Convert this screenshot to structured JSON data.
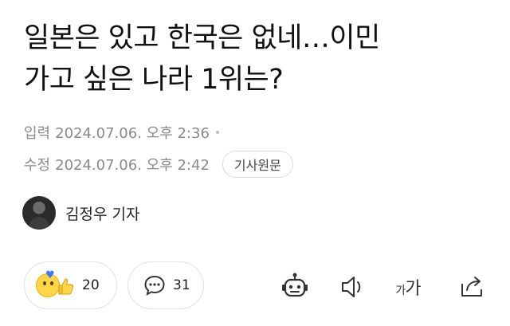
{
  "article": {
    "headline_line1": "일본은 있고 한국은 없네…이민",
    "headline_line2": "가고 싶은 나라 1위는?",
    "input_label": "입력",
    "input_datetime": "2024.07.06. 오후 2:36",
    "edit_label": "수정",
    "edit_datetime": "2024.07.06. 오후 2:42",
    "original_button": "기사원문",
    "reporter": "김정우 기자"
  },
  "actions": {
    "reaction_count": "20",
    "comment_count": "31",
    "font_small": "가",
    "font_large": "가",
    "icons": [
      "emoji-reaction-icon",
      "comment-icon",
      "ai-summary-robot-icon",
      "text-to-speech-icon",
      "font-size-icon",
      "share-icon"
    ]
  },
  "colors": {
    "text": "#111111",
    "meta": "#8a8a8a",
    "border": "#e2e2e2",
    "reaction_heart": "#3a7bf5",
    "reaction_face": "#ffd54a"
  }
}
